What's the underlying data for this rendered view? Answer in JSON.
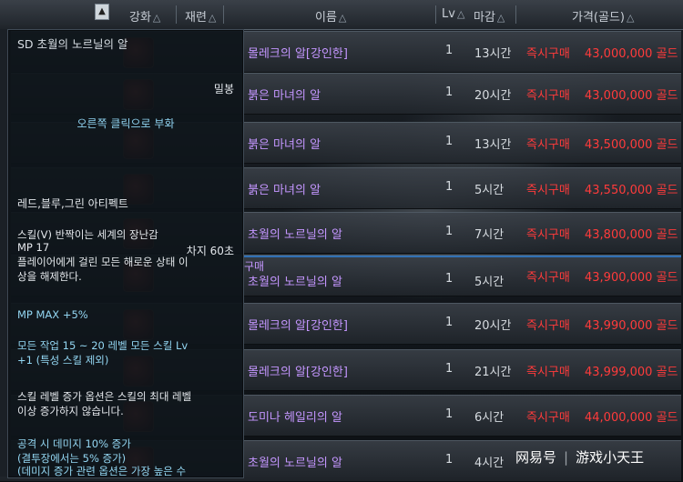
{
  "header": {
    "col_enhance": "강화",
    "col_refine": "재련",
    "col_name": "이름",
    "col_lv": "Lv",
    "col_deadline": "마감",
    "col_price": "가격(골드)",
    "sort_glyph": "△",
    "scroll_glyph": "▲"
  },
  "rows": [
    {
      "name": "몰레크의 알[강인한]",
      "lv": "1",
      "time": "13시간",
      "buy": "즉시구매",
      "price": "43,000,000 골드"
    },
    {
      "name": "붉은 마녀의 알",
      "lv": "1",
      "time": "20시간",
      "buy": "즉시구매",
      "price": "43,000,000 골드"
    },
    {
      "name": "붉은 마녀의 알",
      "lv": "1",
      "time": "13시간",
      "buy": "즉시구매",
      "price": "43,500,000 골드"
    },
    {
      "name": "붉은 마녀의 알",
      "lv": "1",
      "time": "5시간",
      "buy": "즉시구매",
      "price": "43,550,000 골드"
    },
    {
      "name": "초월의 노르닐의 알",
      "lv": "1",
      "time": "7시간",
      "buy": "즉시구매",
      "price": "43,800,000 골드"
    },
    {
      "name": "초월의 노르닐의 알",
      "lv": "1",
      "time": "5시간",
      "buy": "즉시구매",
      "price": "43,900,000 골드"
    },
    {
      "name": "몰레크의 알[강인한]",
      "lv": "1",
      "time": "20시간",
      "buy": "즉시구매",
      "price": "43,990,000 골드"
    },
    {
      "name": "몰레크의 알[강인한]",
      "lv": "1",
      "time": "21시간",
      "buy": "즉시구매",
      "price": "43,999,000 골드"
    },
    {
      "name": "도미나 헤일리의 알",
      "lv": "1",
      "time": "6시간",
      "buy": "즉시구매",
      "price": "44,000,000 골드"
    },
    {
      "name": "초월의 노르닐의 알",
      "lv": "1",
      "time": "4시간",
      "buy": "",
      "price": ""
    }
  ],
  "tooltip": {
    "title": "SD 초월의 노르닐의 알",
    "seal": "밀봉",
    "hint": "오른쪽 클릭으로 부화",
    "artifact": "레드,블루,그린 아티펙트",
    "skill_name": "스킬(V) 반짝이는 세계의 장난감",
    "mp": "MP 17",
    "cooldown": "차지 60초",
    "desc1": "플레이어에게 걸린 모든 해로운 상태 이",
    "desc2": "상을 해제한다.",
    "mpmax": "MP MAX +5%",
    "job1": "모든 작업 15 ~ 20 레벨 모든 스킬 Lv",
    "job2": "+1 (특성 스킬 제외)",
    "lvnote1": "스킬 레벨 증가 옵션은 스킬의 최대 레벨",
    "lvnote2": "이상 증가하지 않습니다.",
    "dmg1": "공격 시 데미지 10% 증가",
    "dmg2": "(결투장에서는 5% 증가)",
    "dmg3": "(데미지 증가 관련 옵션은 가장 높은 수"
  },
  "row5_extra": "구매",
  "watermark": {
    "brand": "网易号",
    "author": "游戏小天王"
  }
}
